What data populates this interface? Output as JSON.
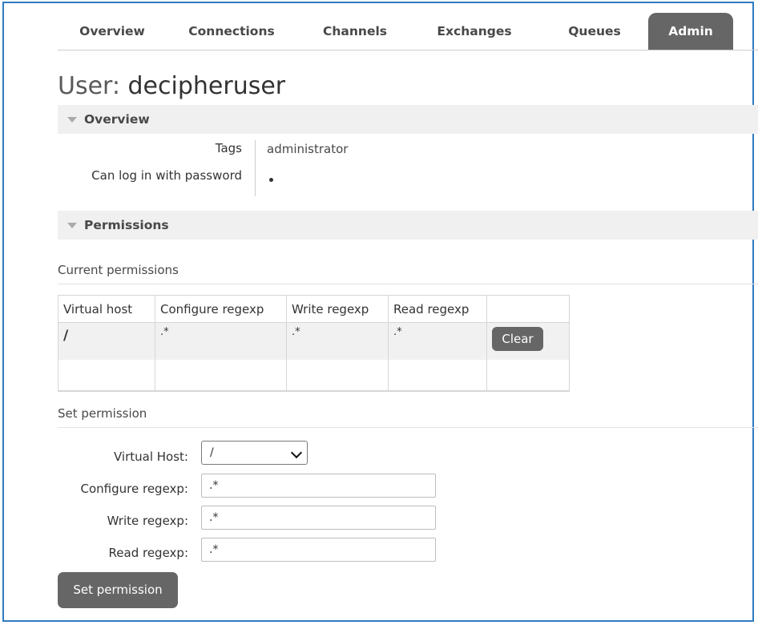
{
  "tabs": [
    "Overview",
    "Connections",
    "Channels",
    "Exchanges",
    "Queues",
    "Admin"
  ],
  "active_tab": "Admin",
  "page": {
    "title_label": "User:",
    "title_name": "decipheruser"
  },
  "overview": {
    "header": "Overview",
    "tags_label": "Tags",
    "tags_value": "administrator",
    "password_label": "Can log in with password",
    "password_value": "•"
  },
  "permissions": {
    "header": "Permissions",
    "current_label": "Current permissions",
    "columns": [
      "Virtual host",
      "Configure regexp",
      "Write regexp",
      "Read regexp"
    ],
    "rows": [
      {
        "vhost": "/",
        "configure": ".*",
        "write": ".*",
        "read": ".*",
        "action": "Clear"
      }
    ]
  },
  "set_permission": {
    "label": "Set permission",
    "vhost_label": "Virtual Host:",
    "vhost_value": "/",
    "configure_label": "Configure regexp:",
    "configure_value": ".*",
    "write_label": "Write regexp:",
    "write_value": ".*",
    "read_label": "Read regexp:",
    "read_value": ".*",
    "button": "Set permission"
  },
  "colors": {
    "accent": "#666666",
    "frame": "#2f7bbf",
    "section_bg": "#f0f0f0"
  }
}
